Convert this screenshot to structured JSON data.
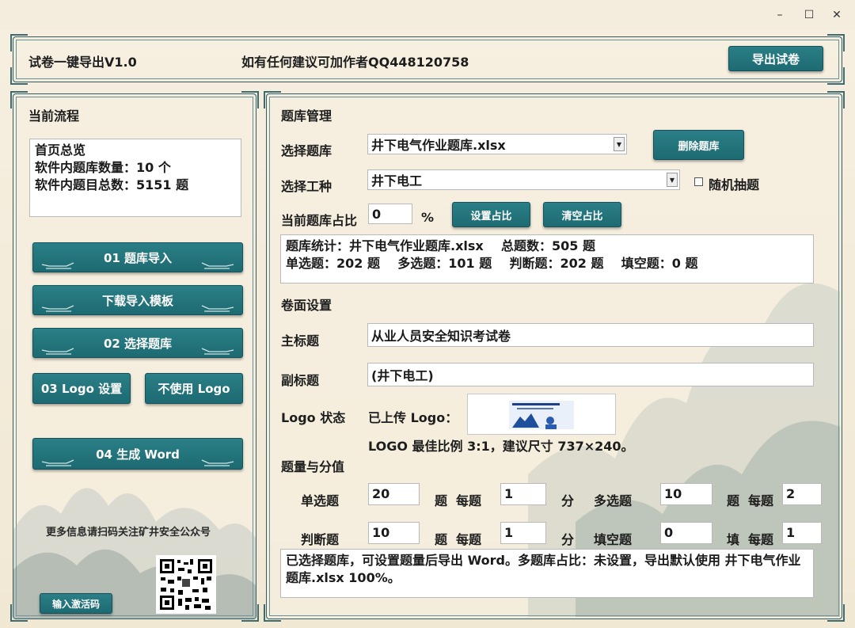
{
  "window": {
    "minimize": "–",
    "maximize": "☐",
    "close": "✕"
  },
  "header": {
    "app_title": "试卷一键导出V1.0",
    "author_note": "如有任何建议可加作者QQ448120758",
    "export_button": "导出试卷"
  },
  "sidebar": {
    "title": "当前流程",
    "overview_lines": [
      "首页总览",
      "软件内题库数量：10 个",
      "软件内题目总数：5151 题"
    ],
    "import_button": "01  题库导入",
    "template_button": "下载导入模板",
    "select_bank_button": "02  选择题库",
    "logo_button": "03  Logo 设置",
    "no_logo_button": "不使用 Logo",
    "generate_button": "04  生成 Word",
    "qr_text": "更多信息请扫码关注矿井安全公众号",
    "activation_button": "输入激活码"
  },
  "bank": {
    "section_title": "题库管理",
    "select_bank_label": "选择题库",
    "select_bank_value": "井下电气作业题库.xlsx",
    "delete_button": "删除题库",
    "select_job_label": "选择工种",
    "select_job_value": "井下电工",
    "random_label": "随机抽题",
    "ratio_label": "当前题库占比",
    "ratio_value": "0",
    "ratio_unit": "%",
    "set_ratio_button": "设置占比",
    "clear_ratio_button": "清空占比",
    "stats_line1": "题库统计：井下电气作业题库.xlsx    总题数：505 题",
    "stats_line2": "单选题：202 题    多选题：101 题    判断题：202 题    填空题：0 题"
  },
  "paper": {
    "section_title": "卷面设置",
    "main_title_label": "主标题",
    "main_title_value": "从业人员安全知识考试卷",
    "sub_title_label": "副标题",
    "sub_title_value": "(井下电工)",
    "logo_status_label": "Logo 状态",
    "logo_uploaded": "已上传 Logo：",
    "logo_hint": "LOGO 最佳比例 3:1，建议尺寸 737×240。"
  },
  "scores": {
    "section_title": "题量与分值",
    "single_label": "单选题",
    "single_count": "20",
    "single_unit": "题",
    "single_each": "每题",
    "single_score": "1",
    "single_score_unit": "分",
    "multi_label": "多选题",
    "multi_count": "10",
    "multi_unit": "题",
    "multi_each": "每题",
    "multi_score": "2",
    "judge_label": "判断题",
    "judge_count": "10",
    "judge_unit": "题",
    "judge_each": "每题",
    "judge_score": "1",
    "judge_score_unit": "分",
    "fill_label": "填空题",
    "fill_count": "0",
    "fill_unit": "填",
    "fill_each": "每题",
    "fill_score": "1"
  },
  "status": {
    "message": "已选择题库，可设置题量后导出 Word。多题库占比：未设置，导出默认使用 井下电气作业题库.xlsx 100%。"
  },
  "colors": {
    "accent": "#1f6f77",
    "frame": "#2f5f66",
    "background": "#f3ebd9"
  }
}
